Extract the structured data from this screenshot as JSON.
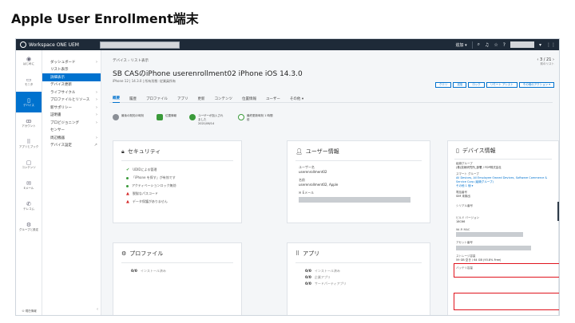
{
  "slide": {
    "title": "Apple User Enrollment端末"
  },
  "topbar": {
    "app_name": "Workspace ONE UEM",
    "region_label": "追加 ▾",
    "icons": [
      "search-icon",
      "bell-icon",
      "star-icon",
      "help-icon",
      "grid-icon"
    ]
  },
  "rail": {
    "items": [
      {
        "label": "はじめに",
        "icon": "home-icon"
      },
      {
        "label": "モニタ",
        "icon": "monitor-icon"
      },
      {
        "label": "デバイス",
        "icon": "device-icon"
      },
      {
        "label": "アカウント",
        "icon": "users-icon"
      },
      {
        "label": "アプリとブック",
        "icon": "apps-icon"
      },
      {
        "label": "コンテンツ",
        "icon": "content-icon"
      },
      {
        "label": "Eメール",
        "icon": "mail-icon"
      },
      {
        "label": "テレコム",
        "icon": "phone-icon"
      },
      {
        "label": "グループと設定",
        "icon": "gear-icon"
      }
    ],
    "footer": "① 現在情報"
  },
  "subnav": {
    "items": [
      {
        "label": "ダッシュボード",
        "chevron": "›"
      },
      {
        "label": "リスト表示",
        "chevron": ""
      },
      {
        "label": "詳細表示",
        "chevron": ""
      },
      {
        "label": "デバイス更新",
        "chevron": ""
      },
      {
        "label": "ライフサイクル",
        "chevron": "›"
      },
      {
        "label": "プロファイルとリソース",
        "chevron": "›"
      },
      {
        "label": "新サポリシー",
        "chevron": "›"
      },
      {
        "label": "証明書",
        "chevron": "›"
      },
      {
        "label": "プロビジョニング",
        "chevron": "›"
      },
      {
        "label": "センサー",
        "chevron": ""
      },
      {
        "label": "周辺機器",
        "chevron": "›"
      },
      {
        "label": "デバイス設定",
        "chevron": "↗"
      }
    ],
    "footer": "‹"
  },
  "main": {
    "breadcrumb": "デバイス  ›  リスト表示",
    "pager": "‹  3 / 21  ›",
    "pager_sub": "前のリスト",
    "device_title": "SB CASのiPhone userenrollment02 iPhone iOS 14.3.0",
    "device_meta": "iPhone 12  |  14.3.0  |  所有形態: 従業員所有",
    "actions": [
      "クエリ",
      "送信",
      "ロック",
      "リモート アシスト",
      "その他のアクション ▾"
    ],
    "tabs": [
      "概要",
      "履歴",
      "プロファイル",
      "アプリ",
      "更新",
      "コンテンツ",
      "位置情報",
      "ユーザー",
      "その他 ▾"
    ],
    "status": [
      {
        "text": "最後の既知の時刻",
        "color": "#8a8f96",
        "date": ""
      },
      {
        "text": "位置情報",
        "color": "#3a9a3a",
        "date": ""
      },
      {
        "text": "ユーザーが加入されました",
        "color": "#3a9a3a",
        "date": "2021/06/14"
      },
      {
        "text": "最終更新時刻  1 時間前",
        "color": "#3a9a3a",
        "date": ""
      }
    ]
  },
  "security": {
    "title": "セキュリティ",
    "items": [
      {
        "text": "UDIDによる管理",
        "state": "ok"
      },
      {
        "text": "「iPhone を探す」が有効です",
        "state": "dot"
      },
      {
        "text": "アクティベーションロック無効",
        "state": "dot"
      },
      {
        "text": "脱獄なパスコード",
        "state": "warn"
      },
      {
        "text": "データ保護がありません",
        "state": "warn"
      }
    ]
  },
  "user_info": {
    "title": "ユーザー情報",
    "username_label": "ユーザー名",
    "username": "userenrollment02",
    "name_label": "名前",
    "name": "userenrollment02, Apple",
    "email_label": "Eメール"
  },
  "profile": {
    "title": "プロファイル",
    "summary": "0/0",
    "summary_label": "インストール済み"
  },
  "apps": {
    "title": "アプリ",
    "rows": [
      {
        "count": "0/0",
        "label": "インストール済み"
      },
      {
        "count": "0/0",
        "label": "企業アプリ"
      },
      {
        "count": "0/0",
        "label": "サードパーティアプリ"
      }
    ]
  },
  "device_info": {
    "title": "デバイス情報",
    "rows": [
      {
        "key": "組織グループ",
        "value": "(株)技術研究所_部署 / FDP株式会社"
      },
      {
        "key": "スマート グループ",
        "link": "All Devices, All Employee Owned Devices, Software Commerce & Service Corp (組織グループ)",
        "more": "その他 1 個 ▾"
      },
      {
        "key": "電話番号",
        "value": "SIM 未検出"
      },
      {
        "key": "シリアル番号",
        "value": ""
      },
      {
        "key": "ビルド バージョン",
        "value": "18C66"
      },
      {
        "key": "Wi-Fi MAC",
        "value": ""
      },
      {
        "key": "アセット番号",
        "value": ""
      },
      {
        "key": "ストレージ容量",
        "value": "59 GB 空き / 64 GB (93.8% Free)"
      },
      {
        "key": "バッテリ容量",
        "value": ""
      }
    ]
  },
  "colors": {
    "accent": "#0072ce",
    "topbar": "#1e2a38",
    "highlight": "#e0141e"
  }
}
